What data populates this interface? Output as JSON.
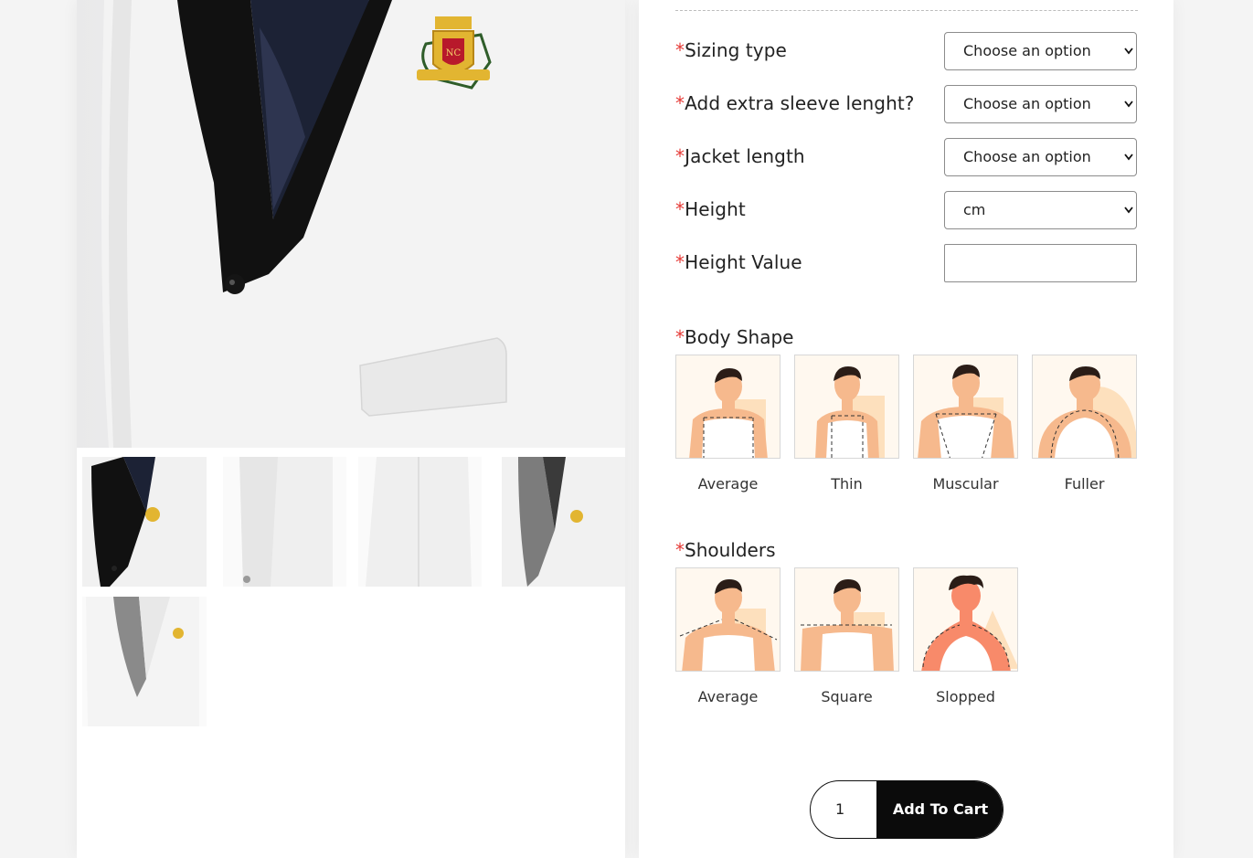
{
  "product_form": {
    "fields": [
      {
        "label": "Sizing type",
        "value": "Choose an option"
      },
      {
        "label": "Add extra sleeve lenght?",
        "value": "Choose an option"
      },
      {
        "label": "Jacket length",
        "value": "Choose an option"
      },
      {
        "label": "Height",
        "value": "cm"
      },
      {
        "label": "Height Value",
        "value": ""
      }
    ],
    "required_mark": "*",
    "body_shape": {
      "title": "Body Shape",
      "options": [
        "Average",
        "Thin",
        "Muscular",
        "Fuller"
      ]
    },
    "shoulders": {
      "title": "Shoulders",
      "options": [
        "Average",
        "Square",
        "Slopped"
      ]
    }
  },
  "cart": {
    "quantity": "1",
    "add_label": "Add To Cart"
  },
  "colors": {
    "accent_required": "#e53935",
    "button_bg": "#0b0b0b",
    "card_bg": "#fff8ef",
    "skin": "#f6b98d",
    "shape_bg": "#fde0bd"
  },
  "gallery": {
    "thumbnails": [
      "jacket-front-shawl-black",
      "jacket-side",
      "jacket-back",
      "jacket-front-shawl-grey",
      "jacket-front-shawl-grey-open"
    ]
  }
}
